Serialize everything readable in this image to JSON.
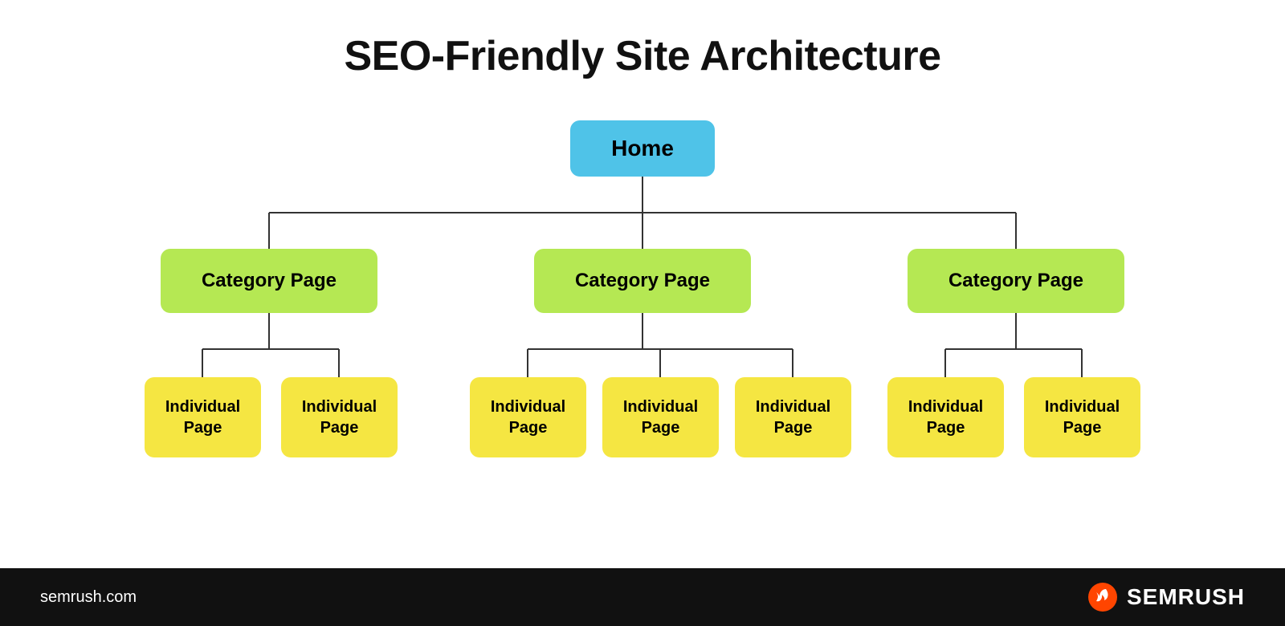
{
  "page": {
    "title": "SEO-Friendly Site Architecture",
    "home_label": "Home",
    "category_label": "Category Page",
    "individual_label": "Individual Page"
  },
  "footer": {
    "url": "semrush.com",
    "brand": "SEMRUSH"
  },
  "colors": {
    "home_bg": "#4fc3e8",
    "category_bg": "#b5e853",
    "individual_bg": "#f5e642",
    "footer_bg": "#111111",
    "semrush_orange": "#ff4500"
  }
}
